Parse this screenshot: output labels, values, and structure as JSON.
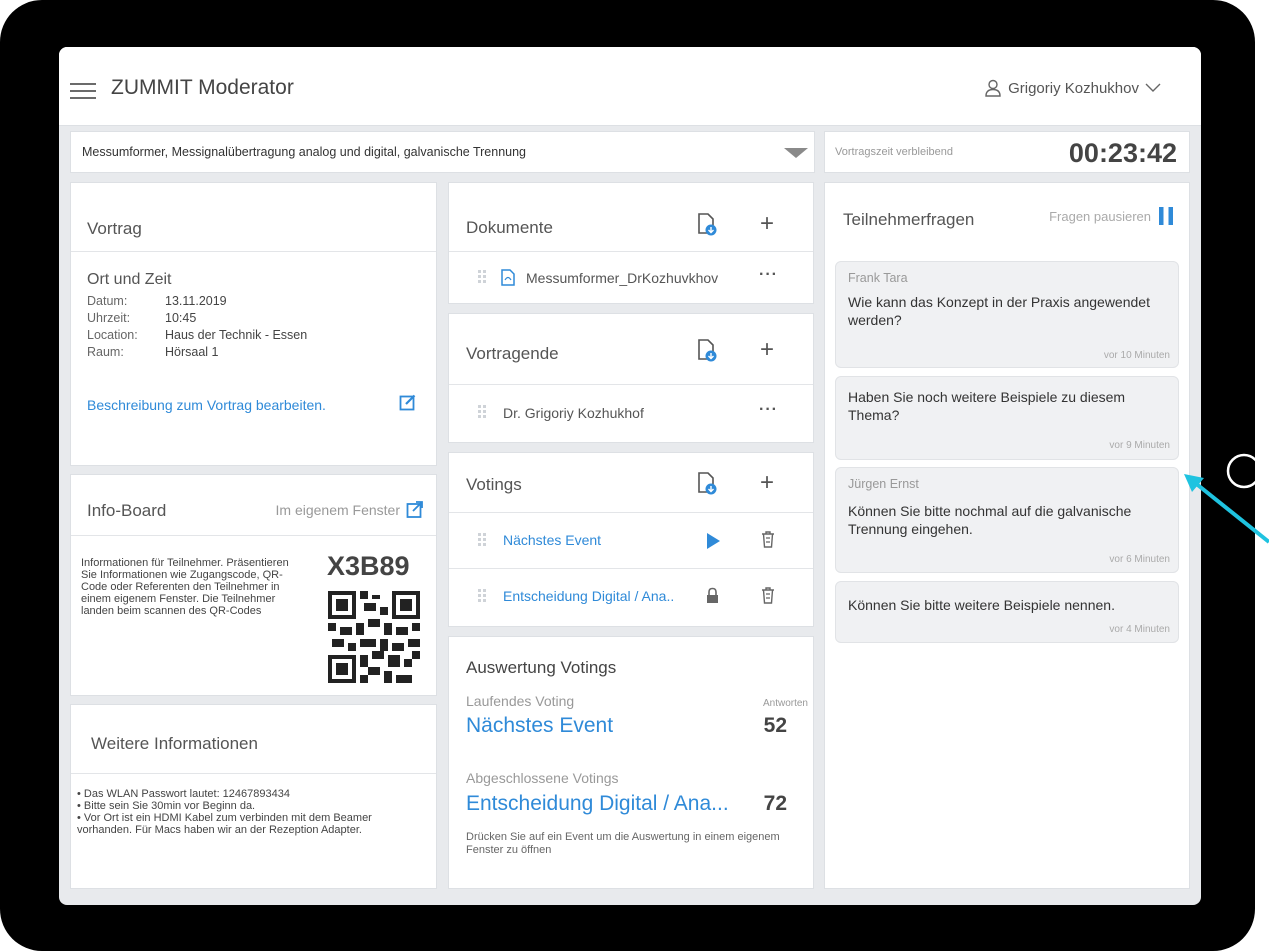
{
  "header": {
    "app_title": "ZUMMIT Moderator",
    "user_name": "Grigoriy Kozhukhov"
  },
  "topic": {
    "selected": "Messumformer, Messignalübertragung analog und digital, galvanische Trennung"
  },
  "timer": {
    "label": "Vortragszeit verbleibend",
    "value": "00:23:42"
  },
  "vortrag": {
    "title": "Vortrag",
    "section": "Ort und Zeit",
    "rows": [
      {
        "label": "Datum:",
        "value": "13.11.2019"
      },
      {
        "label": "Uhrzeit:",
        "value": "10:45"
      },
      {
        "label": "Location:",
        "value": "Haus der Technik - Essen"
      },
      {
        "label": "Raum:",
        "value": "Hörsaal 1"
      }
    ],
    "edit_link": "Beschreibung zum Vortrag bearbeiten."
  },
  "infoboard": {
    "title": "Info-Board",
    "window_link": "Im eigenem Fenster",
    "text": "Informationen für Teilnehmer. Präsentieren Sie Informationen wie Zugangscode, QR-Code oder Referenten den Teilnehmer in einem eigenem Fenster. Die Teilnehmer landen beim scannen des QR-Codes",
    "code": "X3B89"
  },
  "weitere": {
    "title": "Weitere Informationen",
    "lines": [
      "• Das WLAN Passwort lautet: 12467893434",
      "• Bitte sein Sie 30min vor Beginn da.",
      "• Vor Ort ist ein HDMI Kabel zum verbinden mit dem Beamer vorhanden. Für Macs haben wir an der Rezeption Adapter."
    ]
  },
  "dokumente": {
    "title": "Dokumente",
    "items": [
      "Messumformer_DrKozhuvkhov"
    ]
  },
  "vortragende": {
    "title": "Vortragende",
    "items": [
      "Dr. Grigoriy Kozhukhof"
    ]
  },
  "votings": {
    "title": "Votings",
    "items": [
      "Nächstes Event",
      "Entscheidung Digital / Ana.."
    ]
  },
  "auswertung": {
    "title": "Auswertung Votings",
    "running_label": "Laufendes Voting",
    "answers_label": "Antworten",
    "running_name": "Nächstes Event",
    "running_count": "52",
    "closed_label": "Abgeschlossene Votings",
    "closed_name": "Entscheidung Digital / Ana...",
    "closed_count": "72",
    "hint": "Drücken Sie auf ein Event um die Auswertung in einem eigenem Fenster zu öffnen"
  },
  "fragen": {
    "title": "Teilnehmerfragen",
    "pause_label": "Fragen pausieren",
    "questions": [
      {
        "name": "Frank Tara",
        "text": "Wie kann das Konzept in der Praxis angewendet werden?",
        "time": "vor 10 Minuten"
      },
      {
        "name": "",
        "text": "Haben Sie noch weitere Beispiele zu diesem Thema?",
        "time": "vor 9 Minuten"
      },
      {
        "name": "Jürgen Ernst",
        "text": "Können Sie bitte nochmal auf die galvanische Trennung eingehen.",
        "time": "vor 6 Minuten"
      },
      {
        "name": "",
        "text": "Können Sie bitte weitere Beispiele nennen.",
        "time": "vor 4 Minuten"
      }
    ]
  },
  "colors": {
    "accent": "#2f8ad8",
    "bezel": "#000000",
    "pointer_arrow": "#1fc3e0"
  }
}
